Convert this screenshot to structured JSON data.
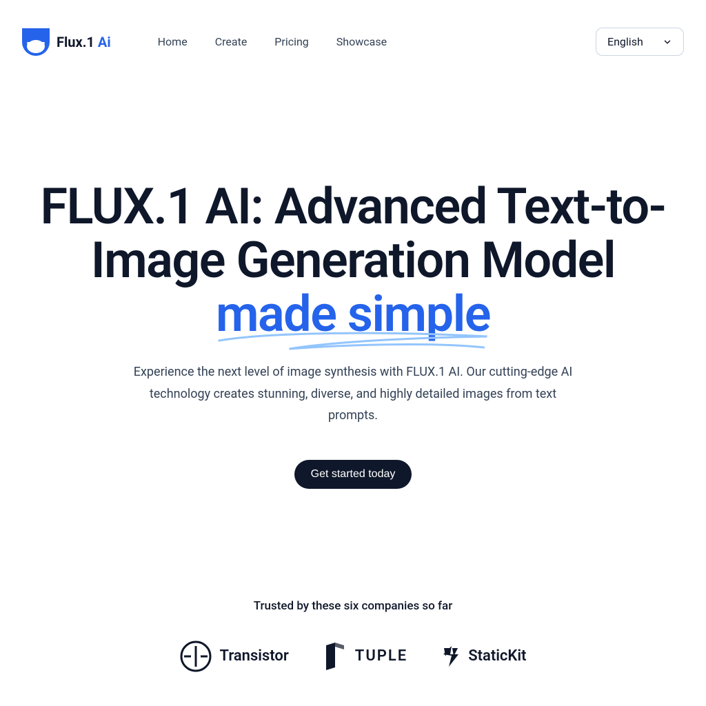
{
  "brand": {
    "name": "Flux.1 ",
    "suffix": "Ai"
  },
  "nav": {
    "home": "Home",
    "create": "Create",
    "pricing": "Pricing",
    "showcase": "Showcase"
  },
  "lang": {
    "selected": "English"
  },
  "hero": {
    "title_plain": "FLUX.1 AI: Advanced Text-to-Image Generation Model ",
    "title_highlight": "made simple",
    "subtitle": "Experience the next level of image synthesis with FLUX.1 AI. Our cutting-edge AI technology creates stunning, diverse, and highly detailed images from text prompts.",
    "cta": "Get started today"
  },
  "trusted": {
    "text": "Trusted by these six companies so far",
    "companies": {
      "transistor": "Transistor",
      "tuple": "TUPLE",
      "statickit": "StaticKit"
    }
  }
}
